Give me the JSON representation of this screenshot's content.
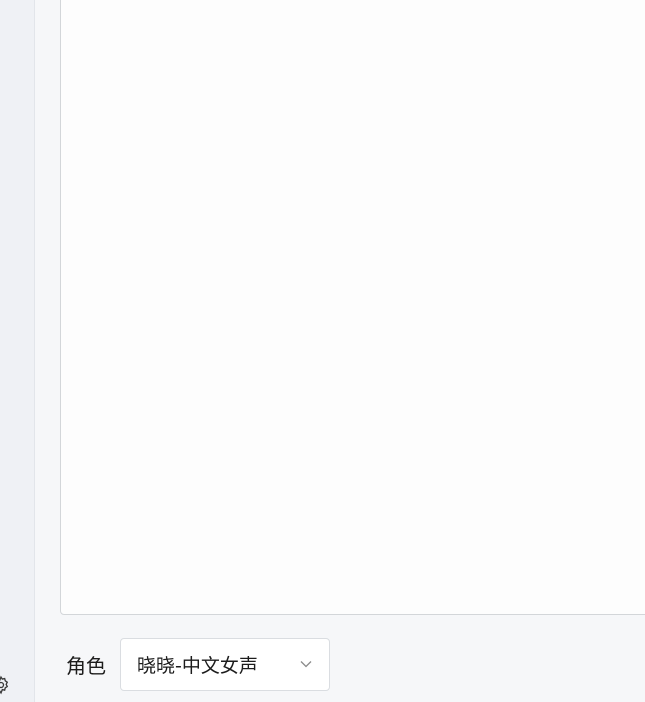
{
  "icons": {
    "settings": "gear-icon",
    "dropdown": "chevron-down-icon"
  },
  "editor": {
    "value": ""
  },
  "voice": {
    "label": "角色",
    "selected": "晓晓-中文女声"
  },
  "colors": {
    "sidebar_bg": "#eff1f5",
    "main_bg": "#f6f7f9",
    "editor_bg": "#fdfdfd"
  }
}
